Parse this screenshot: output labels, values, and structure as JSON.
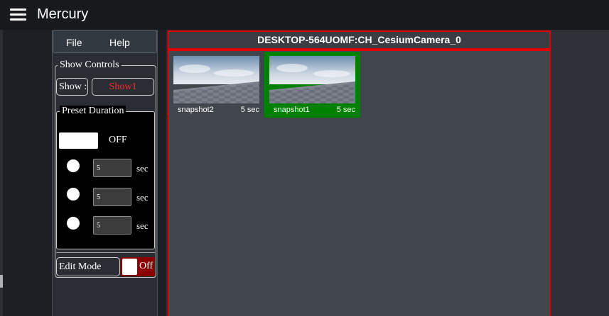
{
  "app": {
    "title": "Mercury"
  },
  "menu": {
    "file_label": "File",
    "help_label": "Help"
  },
  "show_controls": {
    "legend": "Show Controls",
    "show_label": "Show :",
    "show_value": "Show1",
    "preset_duration": {
      "legend": "Preset Duration",
      "toggle_state": "OFF",
      "presets": [
        {
          "value": "5",
          "unit": "sec"
        },
        {
          "value": "5",
          "unit": "sec"
        },
        {
          "value": "5",
          "unit": "sec"
        }
      ]
    },
    "edit_mode": {
      "label": "Edit Mode",
      "state": "Off"
    }
  },
  "camera": {
    "title": "DESKTOP-564UOMF:CH_CesiumCamera_0",
    "snapshots": [
      {
        "name": "snapshot2",
        "duration": "5 sec",
        "selected": false
      },
      {
        "name": "snapshot1",
        "duration": "5 sec",
        "selected": true
      }
    ]
  },
  "colors": {
    "active_border": "#e00000",
    "selected_snapshot": "#008000",
    "show_value_text": "#ff2a2a",
    "edit_toggle_off": "#8b0000"
  }
}
